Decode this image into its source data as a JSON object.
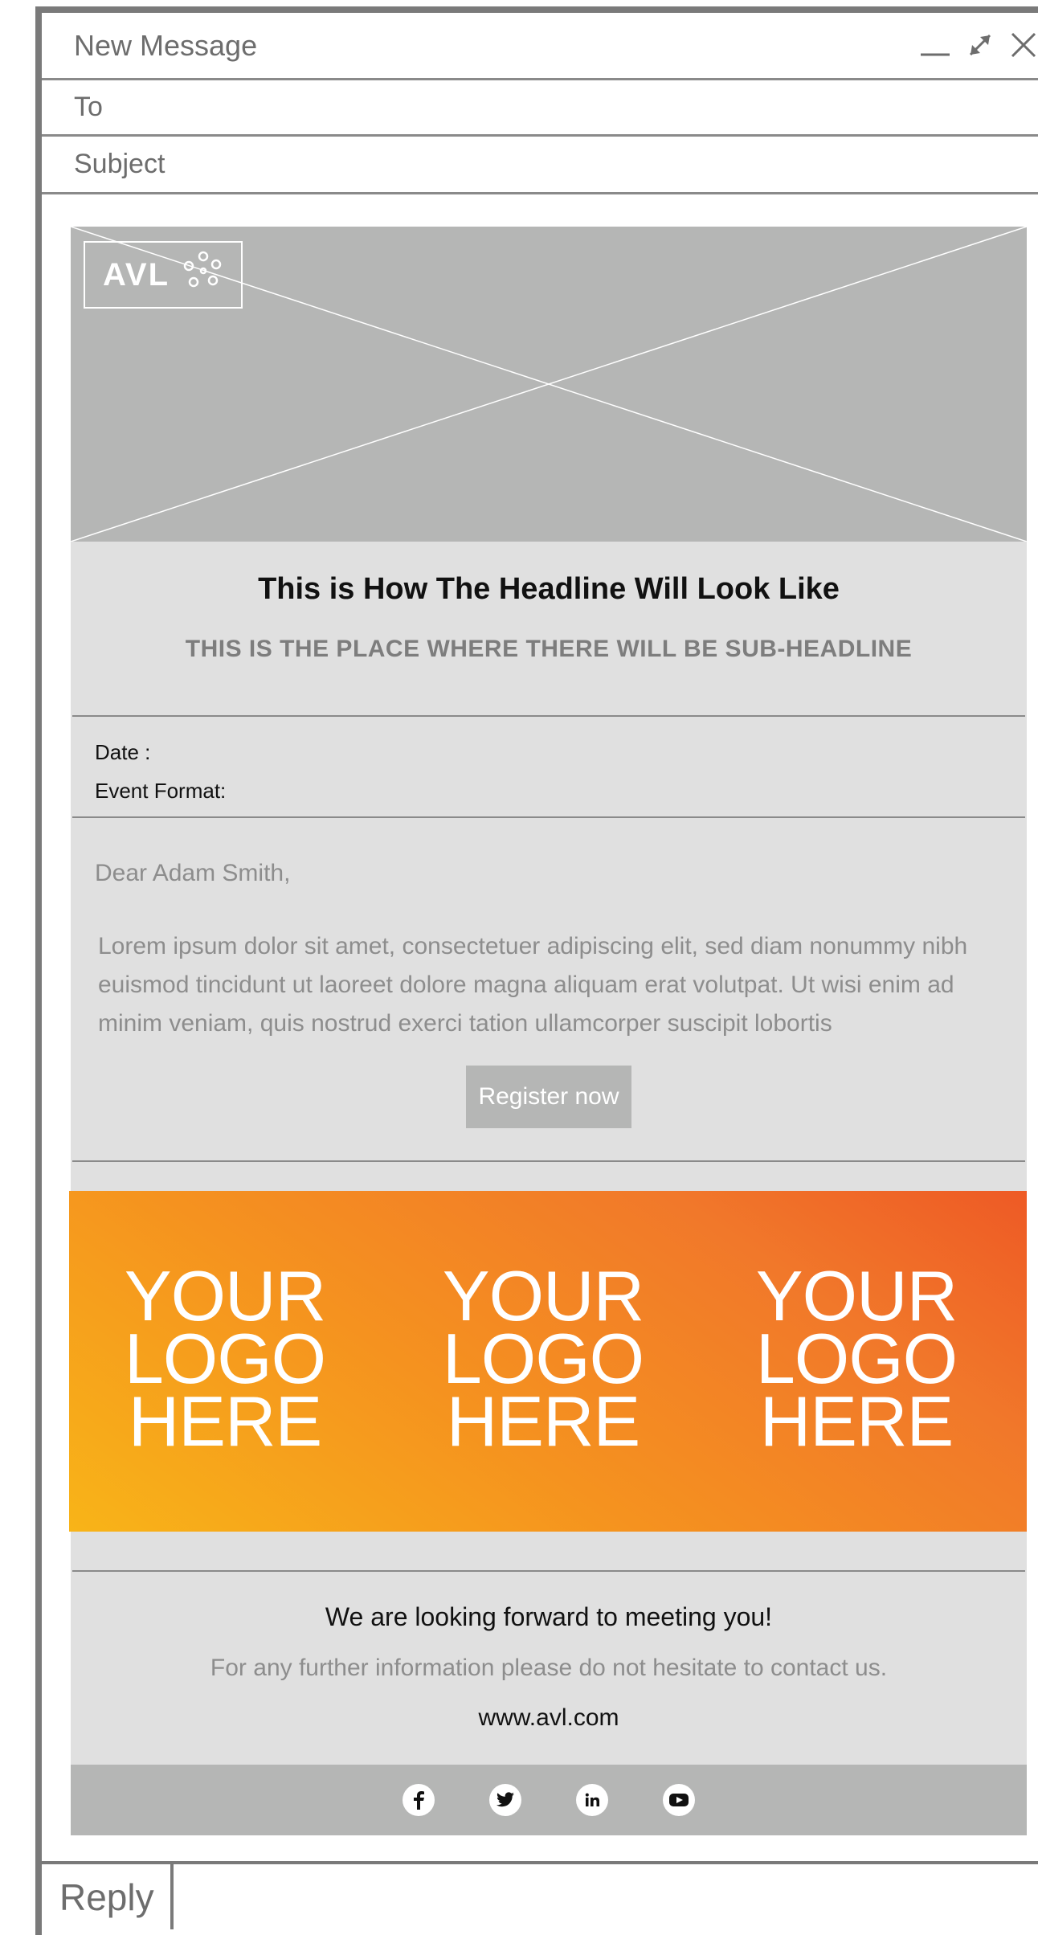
{
  "window": {
    "title": "New Message",
    "to_label": "To",
    "subject_label": "Subject",
    "controls": [
      "minimize-icon",
      "expand-icon",
      "close-icon"
    ]
  },
  "email": {
    "brand": "AVL",
    "headline": "This is How The Headline Will Look Like",
    "subheadline": "THIS IS THE PLACE WHERE THERE WILL BE SUB-HEADLINE",
    "date_label": "Date :",
    "format_label": "Event Format:",
    "greeting": "Dear Adam Smith,",
    "paragraph": "Lorem ipsum dolor sit amet, consectetuer adipiscing elit, sed diam nonummy nibh euismod tincidunt ut laoreet dolore magna aliquam erat volutpat. Ut wisi enim ad minim veniam, quis nostrud exerci tation ullamcorper suscipit lobortis",
    "register_label": "Register now",
    "logos": [
      {
        "line1": "YOUR",
        "line2": "LOGO",
        "line3": "HERE"
      },
      {
        "line1": "YOUR",
        "line2": "LOGO",
        "line3": "HERE"
      },
      {
        "line1": "YOUR",
        "line2": "LOGO",
        "line3": "HERE"
      }
    ],
    "footer_line1": "We are looking forward to meeting you!",
    "footer_line2": "For any further information please do not hesitate to contact us.",
    "website": "www.avl.com",
    "social": [
      "facebook-icon",
      "twitter-icon",
      "linkedin-icon",
      "youtube-icon"
    ]
  },
  "reply_label": "Reply",
  "colors": {
    "frame": "#7a7a7a",
    "placeholder_grey": "#b5b6b5",
    "panel_grey": "#e0e0e0",
    "gradient_start": "#f8b418",
    "gradient_end": "#ee5a25"
  }
}
